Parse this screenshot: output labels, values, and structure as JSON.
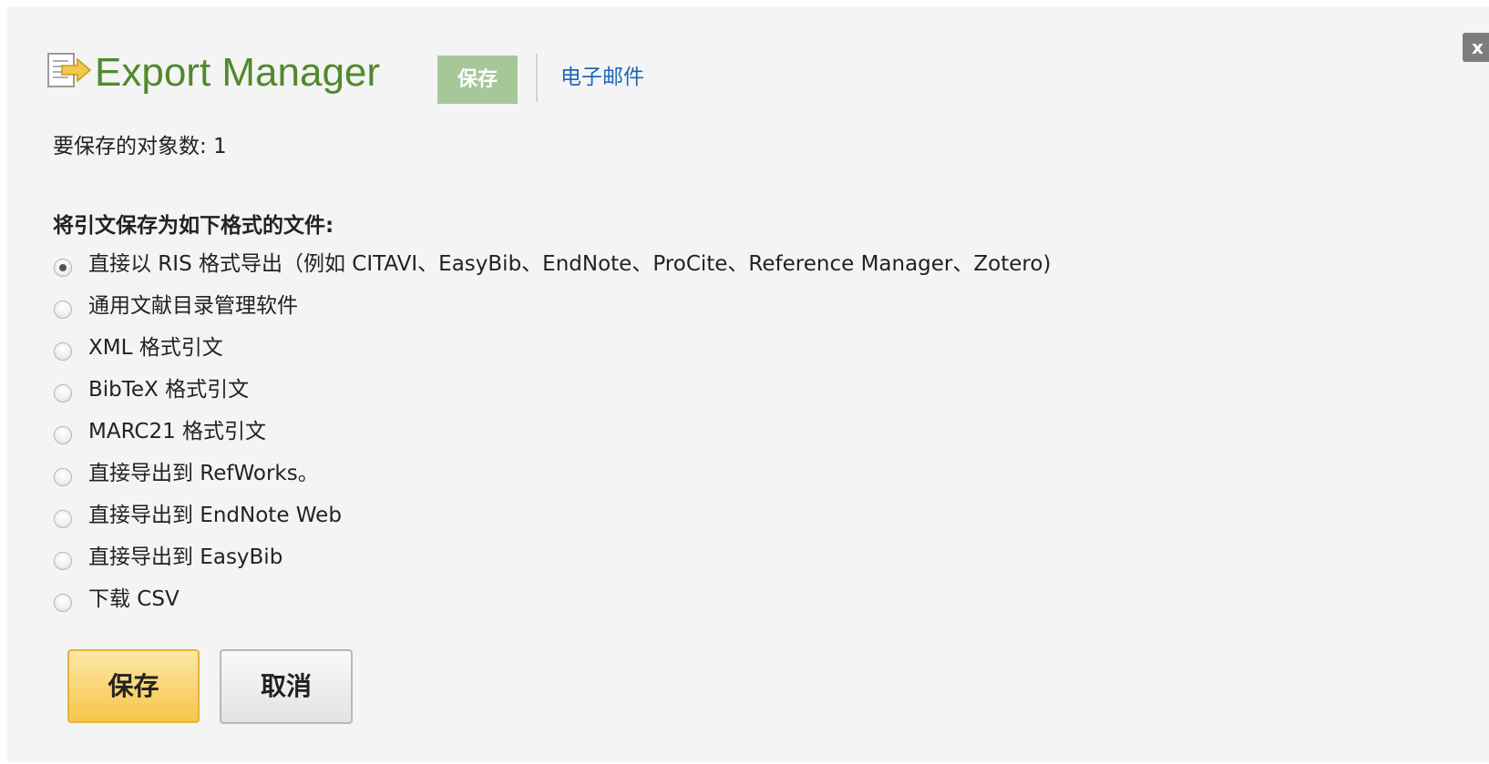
{
  "dialog": {
    "title": "Export Manager",
    "close_label": "x",
    "title_icon": "document-export-icon"
  },
  "tabs": [
    {
      "label": "保存",
      "active": true
    },
    {
      "label": "电子邮件",
      "active": false
    }
  ],
  "object_count_text": "要保存的对象数: 1",
  "format_heading": "将引文保存为如下格式的文件:",
  "format_options": [
    {
      "label": "直接以 RIS 格式导出（例如 CITAVI、EasyBib、EndNote、ProCite、Reference Manager、Zotero)",
      "selected": true
    },
    {
      "label": "通用文献目录管理软件",
      "selected": false
    },
    {
      "label": "XML 格式引文",
      "selected": false
    },
    {
      "label": "BibTeX 格式引文",
      "selected": false
    },
    {
      "label": "MARC21 格式引文",
      "selected": false
    },
    {
      "label": "直接导出到 RefWorks。",
      "selected": false
    },
    {
      "label": "直接导出到 EndNote Web",
      "selected": false
    },
    {
      "label": "直接导出到 EasyBib",
      "selected": false
    },
    {
      "label": "下载 CSV",
      "selected": false
    }
  ],
  "buttons": {
    "save_label": "保存",
    "cancel_label": "取消"
  },
  "colors": {
    "title_green": "#4f8a2c",
    "active_tab_bg": "#a6c797",
    "link_blue": "#1f66b8",
    "save_button": "#f7c54a",
    "dialog_bg": "#f4f4f4"
  }
}
